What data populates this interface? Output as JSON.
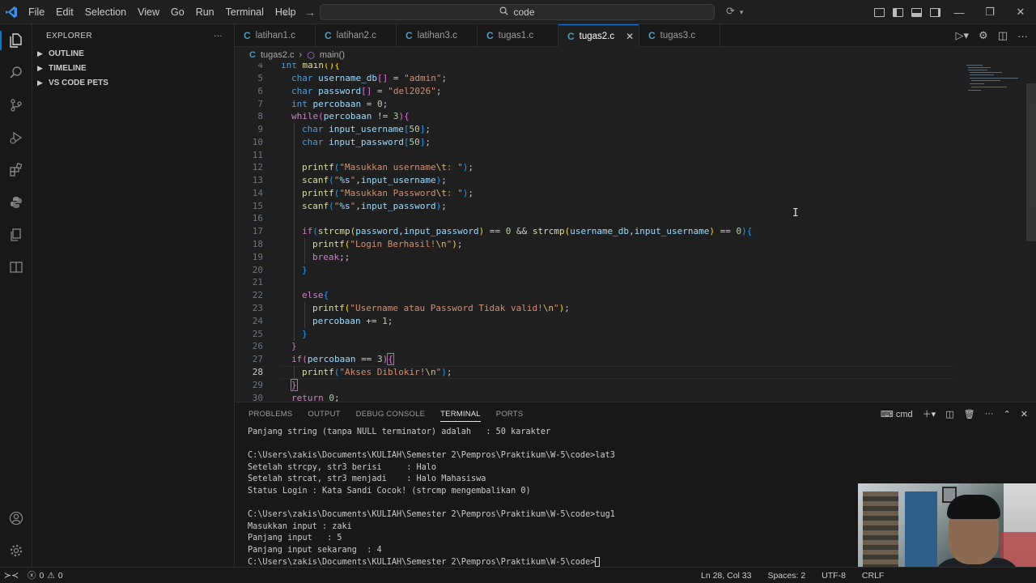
{
  "titlebar": {
    "menus": [
      "File",
      "Edit",
      "Selection",
      "View",
      "Go",
      "Run",
      "Terminal",
      "Help"
    ],
    "search_text": "code"
  },
  "sidebar": {
    "title": "EXPLORER",
    "more": "···",
    "sections": [
      "OUTLINE",
      "TIMELINE",
      "VS CODE PETS"
    ]
  },
  "tabs": [
    {
      "label": "latihan1.c"
    },
    {
      "label": "latihan2.c"
    },
    {
      "label": "latihan3.c"
    },
    {
      "label": "tugas1.c"
    },
    {
      "label": "tugas2.c"
    },
    {
      "label": "tugas3.c"
    }
  ],
  "breadcrumb": {
    "file": "tugas2.c",
    "symbol": "main()"
  },
  "editor": {
    "line_numbers": [
      "4",
      "5",
      "6",
      "7",
      "8",
      "9",
      "10",
      "11",
      "12",
      "13",
      "14",
      "15",
      "16",
      "17",
      "18",
      "19",
      "20",
      "21",
      "22",
      "23",
      "24",
      "25",
      "26",
      "27",
      "28",
      "29",
      "30"
    ],
    "current_line": "28"
  },
  "panel": {
    "tabs": [
      "PROBLEMS",
      "OUTPUT",
      "DEBUG CONSOLE",
      "TERMINAL",
      "PORTS"
    ],
    "shell": "cmd",
    "terminal_lines": [
      "Panjang string (tanpa NULL terminator) adalah   : 50 karakter",
      "",
      "C:\\Users\\zakis\\Documents\\KULIAH\\Semester 2\\Pempros\\Praktikum\\W-5\\code>lat3",
      "Setelah strcpy, str3 berisi     : Halo",
      "Setelah strcat, str3 menjadi    : Halo Mahasiswa",
      "Status Login : Kata Sandi Cocok! (strcmp mengembalikan 0)",
      "",
      "C:\\Users\\zakis\\Documents\\KULIAH\\Semester 2\\Pempros\\Praktikum\\W-5\\code>tug1",
      "Masukkan input : zaki",
      "Panjang input   : 5",
      "Panjang input sekarang  : 4"
    ],
    "prompt": "C:\\Users\\zakis\\Documents\\KULIAH\\Semester 2\\Pempros\\Praktikum\\W-5\\code>"
  },
  "statusbar": {
    "errors": "0",
    "warnings": "0",
    "cursor": "Ln 28, Col 33",
    "spaces": "Spaces: 2",
    "encoding": "UTF-8",
    "eol": "CRLF"
  },
  "colors": {
    "accent": "#0078d4",
    "background": "#1f1f1f",
    "sidebar_bg": "#181818"
  }
}
